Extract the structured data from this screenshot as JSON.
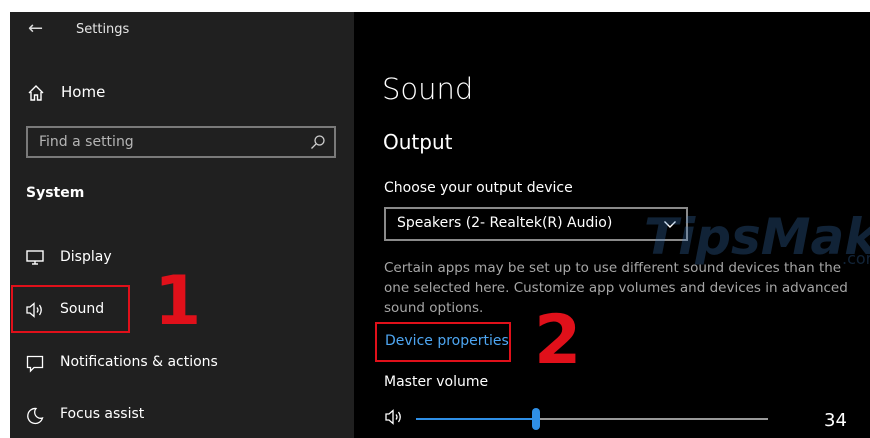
{
  "window": {
    "title": "Settings"
  },
  "sidebar": {
    "home_label": "Home",
    "search": {
      "placeholder": "Find a setting"
    },
    "section_title": "System",
    "items": [
      {
        "label": "Display",
        "icon": "display-icon"
      },
      {
        "label": "Sound",
        "icon": "speaker-icon",
        "selected": true
      },
      {
        "label": "Notifications & actions",
        "icon": "notifications-icon"
      },
      {
        "label": "Focus assist",
        "icon": "moon-icon"
      }
    ]
  },
  "main": {
    "page_title": "Sound",
    "section_title": "Output",
    "device_label": "Choose your output device",
    "device_value": "Speakers (2- Realtek(R) Audio)",
    "help_text": "Certain apps may be set up to use different sound devices than the one selected here. Customize app volumes and devices in advanced sound options.",
    "device_properties_link": "Device properties",
    "master_volume_label": "Master volume",
    "volume": 34
  },
  "annotations": {
    "callout_1": "1",
    "callout_2": "2"
  },
  "watermark": {
    "text": "TipsMake",
    "suffix": ".com"
  },
  "colors": {
    "sidebar_bg": "#202020",
    "main_bg": "#000000",
    "accent": "#2f8fe6",
    "link": "#4ea6f2",
    "annotation_red": "#e0101a"
  }
}
